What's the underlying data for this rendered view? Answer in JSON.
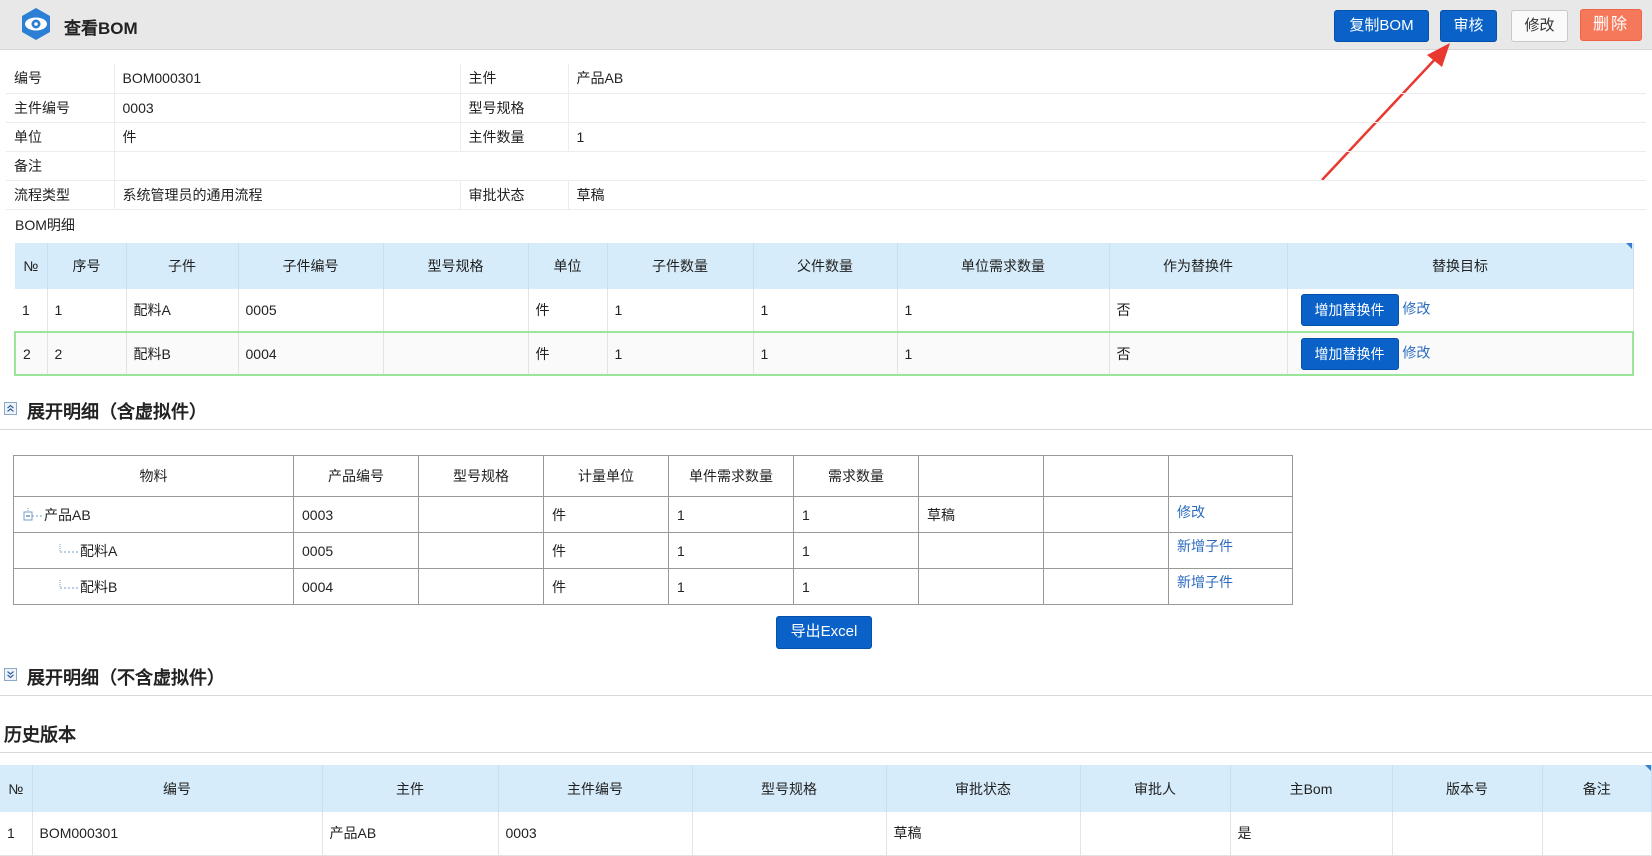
{
  "header": {
    "title": "查看BOM",
    "buttons": {
      "copy": "复制BOM",
      "approve": "审核",
      "edit": "修改",
      "delete": "删除"
    }
  },
  "info": {
    "rows": [
      {
        "l1": "编号",
        "v1": "BOM000301",
        "l2": "主件",
        "v2": "产品AB"
      },
      {
        "l1": "主件编号",
        "v1": "0003",
        "l2": "型号规格",
        "v2": ""
      },
      {
        "l1": "单位",
        "v1": "件",
        "l2": "主件数量",
        "v2": "1"
      },
      {
        "l1": "备注",
        "v1": "",
        "l2": "",
        "v2": ""
      },
      {
        "l1": "流程类型",
        "v1": "系统管理员的通用流程",
        "l2": "审批状态",
        "v2": "草稿"
      }
    ]
  },
  "bom": {
    "label": "BOM明细",
    "headers": [
      "№",
      "序号",
      "子件",
      "子件编号",
      "型号规格",
      "单位",
      "子件数量",
      "父件数量",
      "单位需求数量",
      "作为替换件",
      "替换目标"
    ],
    "rows": [
      {
        "no": "1",
        "seq": "1",
        "part": "配料A",
        "code": "0005",
        "spec": "",
        "unit": "件",
        "qty": "1",
        "parent_qty": "1",
        "unit_demand": "1",
        "is_sub": "否"
      },
      {
        "no": "2",
        "seq": "2",
        "part": "配料B",
        "code": "0004",
        "spec": "",
        "unit": "件",
        "qty": "1",
        "parent_qty": "1",
        "unit_demand": "1",
        "is_sub": "否"
      }
    ],
    "add_sub_label": "增加替换件",
    "edit_label": "修改"
  },
  "expand1": {
    "title": "展开明细（含虚拟件）",
    "headers": [
      "物料",
      "产品编号",
      "型号规格",
      "计量单位",
      "单件需求数量",
      "需求数量",
      "",
      "",
      ""
    ],
    "rows": [
      {
        "name": "产品AB",
        "code": "0003",
        "spec": "",
        "unit": "件",
        "unit_qty": "1",
        "qty": "1",
        "status": "草稿",
        "extra": "",
        "action": "修改"
      },
      {
        "name": "配料A",
        "code": "0005",
        "spec": "",
        "unit": "件",
        "unit_qty": "1",
        "qty": "1",
        "status": "",
        "extra": "",
        "action": "新增子件"
      },
      {
        "name": "配料B",
        "code": "0004",
        "spec": "",
        "unit": "件",
        "unit_qty": "1",
        "qty": "1",
        "status": "",
        "extra": "",
        "action": "新增子件"
      }
    ],
    "export_label": "导出Excel"
  },
  "expand2": {
    "title": "展开明细（不含虚拟件）"
  },
  "history": {
    "title": "历史版本",
    "headers": [
      "№",
      "编号",
      "主件",
      "主件编号",
      "型号规格",
      "审批状态",
      "审批人",
      "主Bom",
      "版本号",
      "备注"
    ],
    "rows": [
      {
        "no": "1",
        "code": "BOM000301",
        "main": "产品AB",
        "main_code": "0003",
        "spec": "",
        "status": "草稿",
        "approver": "",
        "main_bom": "是",
        "version": "",
        "note": ""
      }
    ]
  },
  "colors": {
    "primary": "#0a62c9",
    "danger": "#f6785a",
    "header_row": "#d6ecfa",
    "link": "#2b6cc0",
    "annotation_arrow": "#e8382f"
  },
  "icons": {
    "logo": "eye-icon",
    "collapse": "double-chevron-up-icon",
    "expand": "double-chevron-down-icon",
    "tree_minus": "tree-collapse-icon"
  }
}
